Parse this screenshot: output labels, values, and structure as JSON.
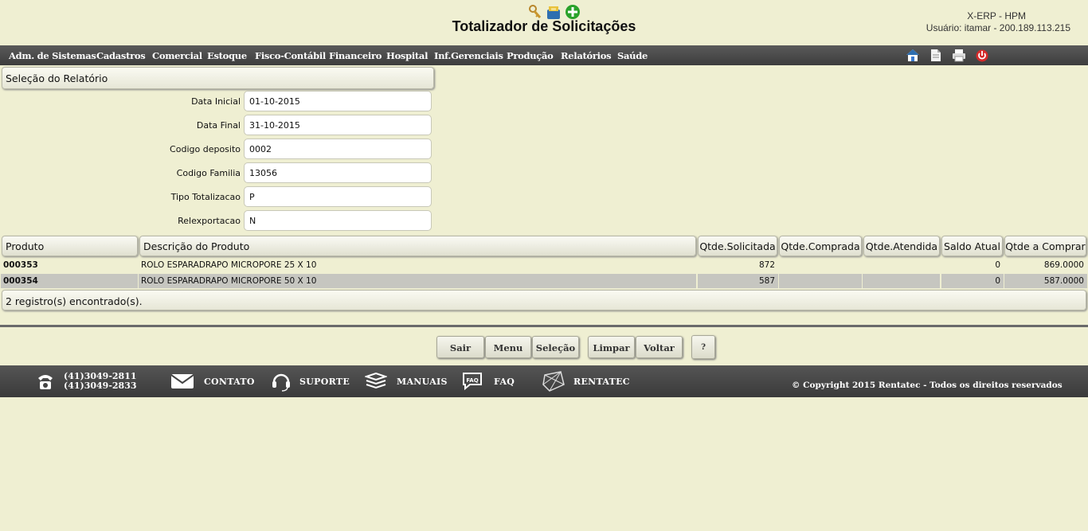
{
  "header": {
    "title": "Totalizador de Solicitações",
    "system": "X-ERP - HPM",
    "user": "Usuário: itamar - 200.189.113.215",
    "icons": [
      "keys-icon",
      "briefcase-icon",
      "add-circle-icon"
    ]
  },
  "menu": {
    "items": [
      "Adm. de Sistemas",
      "Cadastros",
      "Comercial",
      "Estoque",
      "Fisco-Contábil",
      "Financeiro",
      "Hospital",
      "Inf.Gerenciais",
      "Produção",
      "Relatórios",
      "Saúde"
    ],
    "tools": [
      "home-icon",
      "document-icon",
      "print-icon",
      "power-icon"
    ]
  },
  "selection": {
    "heading": "Seleção do Relatório",
    "fields": [
      {
        "label": "Data Inicial",
        "value": "01-10-2015"
      },
      {
        "label": "Data Final",
        "value": "31-10-2015"
      },
      {
        "label": "Codigo deposito",
        "value": "0002"
      },
      {
        "label": "Codigo Familia",
        "value": "13056"
      },
      {
        "label": "Tipo Totalizacao",
        "value": "P"
      },
      {
        "label": "Relexportacao",
        "value": "N"
      }
    ]
  },
  "table": {
    "columns": [
      "Produto",
      "Descrição do Produto",
      "Qtde.Solicitada",
      "Qtde.Comprada",
      "Qtde.Atendida",
      "Saldo Atual",
      "Qtde a Comprar"
    ],
    "rows": [
      [
        "000353",
        "ROLO ESPARADRAPO MICROPORE 25 X 10",
        "872",
        "",
        "",
        "0",
        "869.0000"
      ],
      [
        "000354",
        "ROLO ESPARADRAPO MICROPORE 50 X 10",
        "587",
        "",
        "",
        "0",
        "587.0000"
      ]
    ],
    "count_text": "2 registro(s) encontrado(s)."
  },
  "buttons": {
    "sair": "Sair",
    "menu": "Menu",
    "selecao": "Seleção",
    "limpar": "Limpar",
    "voltar": "Voltar",
    "help": "?"
  },
  "footer": {
    "phone1": "(41)3049-2811",
    "phone2": "(41)3049-2833",
    "contato": "CONTATO",
    "suporte": "SUPORTE",
    "manuais": "MANUAIS",
    "faq": "FAQ",
    "rentatec": "RENTATEC",
    "copyright": "© Copyright 2015 Rentatec - Todos os direitos reservados"
  }
}
